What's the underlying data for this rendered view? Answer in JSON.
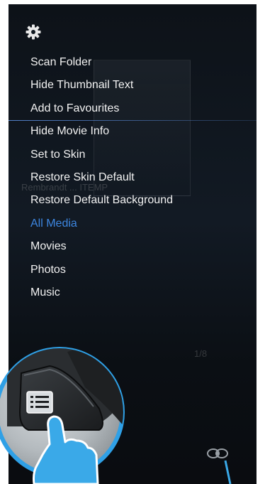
{
  "background": {
    "thumbnail_caption": "Rembrandt ... ITEMP",
    "page_counter": "1/8"
  },
  "header": {
    "icon": "gear-icon"
  },
  "menu": {
    "items": [
      {
        "label": "Scan Folder",
        "state": "normal"
      },
      {
        "label": "Hide Thumbnail Text",
        "state": "normal"
      },
      {
        "label": "Add to Favourites",
        "state": "focused"
      },
      {
        "label": "Hide Movie Info",
        "state": "normal"
      },
      {
        "label": "Set to Skin",
        "state": "normal"
      },
      {
        "label": "Restore Skin Default",
        "state": "normal"
      },
      {
        "label": "Restore Default Background",
        "state": "normal"
      },
      {
        "label": "All Media",
        "state": "selected"
      },
      {
        "label": "Movies",
        "state": "normal"
      },
      {
        "label": "Photos",
        "state": "normal"
      },
      {
        "label": "Music",
        "state": "normal"
      }
    ]
  },
  "overlay": {
    "remote_button_icon": "menu-list-icon",
    "hand_icon": "pointing-hand-icon",
    "connection_icon": "remote-link-icon"
  },
  "colors": {
    "selected_text": "#3d86e0",
    "menu_text": "#f2f2f2",
    "focus_line": "#5a8cdc",
    "hand": "#3aa9e8"
  }
}
